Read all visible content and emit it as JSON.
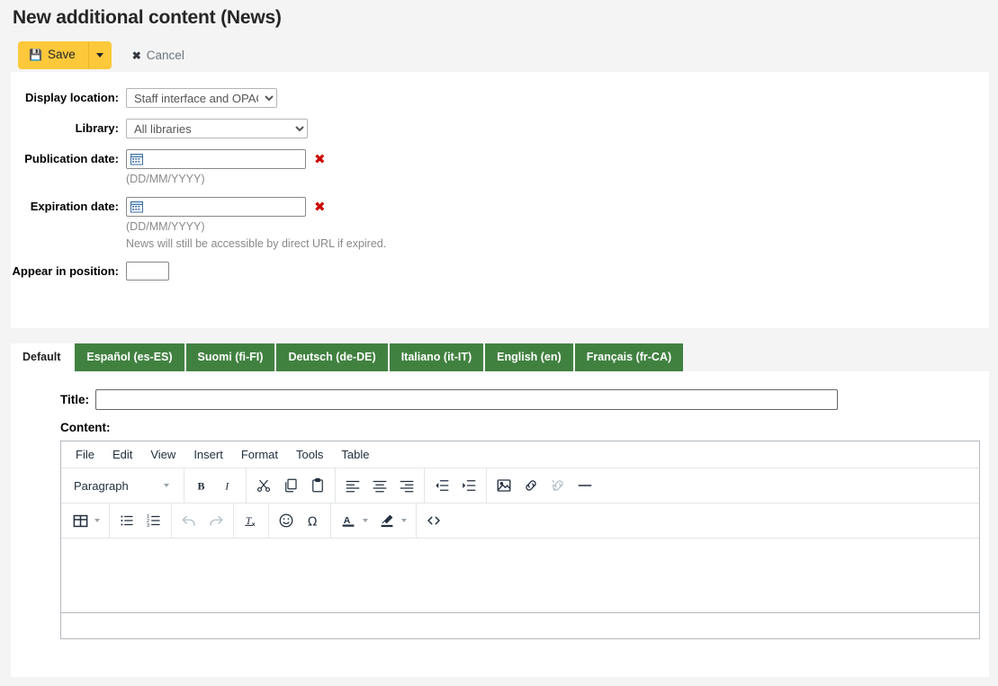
{
  "page": {
    "title": "New additional content (News)"
  },
  "toolbar": {
    "save_label": "Save",
    "save_icon": "floppy-disk-icon",
    "save_dropdown_icon": "caret-down-icon",
    "cancel_label": "Cancel",
    "cancel_icon": "x-icon"
  },
  "form": {
    "display_location": {
      "label": "Display location:",
      "value": "Staff interface and OPAC",
      "options": [
        "Staff interface and OPAC"
      ]
    },
    "library": {
      "label": "Library:",
      "value": "All libraries",
      "options": [
        "All libraries"
      ]
    },
    "publication_date": {
      "label": "Publication date:",
      "value": "",
      "hint": "(DD/MM/YYYY)",
      "clear_icon": "red-x-icon",
      "calendar_icon": "calendar-icon"
    },
    "expiration_date": {
      "label": "Expiration date:",
      "value": "",
      "hint": "(DD/MM/YYYY)",
      "hint2": "News will still be accessible by direct URL if expired.",
      "clear_icon": "red-x-icon",
      "calendar_icon": "calendar-icon"
    },
    "appear_in_position": {
      "label": "Appear in position:",
      "value": ""
    }
  },
  "language_tabs": [
    {
      "label": "Default",
      "active": true
    },
    {
      "label": "Español (es-ES)",
      "active": false
    },
    {
      "label": "Suomi (fi-FI)",
      "active": false
    },
    {
      "label": "Deutsch (de-DE)",
      "active": false
    },
    {
      "label": "Italiano (it-IT)",
      "active": false
    },
    {
      "label": "English (en)",
      "active": false
    },
    {
      "label": "Français (fr-CA)",
      "active": false
    }
  ],
  "content_tab": {
    "title_label": "Title:",
    "title_value": "",
    "content_label": "Content:",
    "editor_value": ""
  },
  "editor": {
    "menubar": [
      "File",
      "Edit",
      "View",
      "Insert",
      "Format",
      "Tools",
      "Table"
    ],
    "format_select": "Paragraph",
    "toolbar_row1": [
      "bold-icon",
      "italic-icon",
      "cut-icon",
      "copy-icon",
      "paste-icon",
      "align-left-icon",
      "align-center-icon",
      "align-right-icon",
      "outdent-icon",
      "indent-icon",
      "insert-image-icon",
      "insert-link-icon",
      "unlink-icon",
      "horizontal-rule-icon"
    ],
    "toolbar_row2": [
      "table-icon",
      "bullet-list-icon",
      "numbered-list-icon",
      "undo-icon",
      "redo-icon",
      "clear-formatting-icon",
      "emoticon-icon",
      "special-character-icon",
      "text-color-icon",
      "background-color-icon",
      "source-code-icon"
    ]
  },
  "colors": {
    "accent_save": "#fdc83a",
    "tab_green": "#418140",
    "page_bg": "#f4f4f4",
    "panel_bg": "#ffffff",
    "danger_red": "#cc0000"
  }
}
